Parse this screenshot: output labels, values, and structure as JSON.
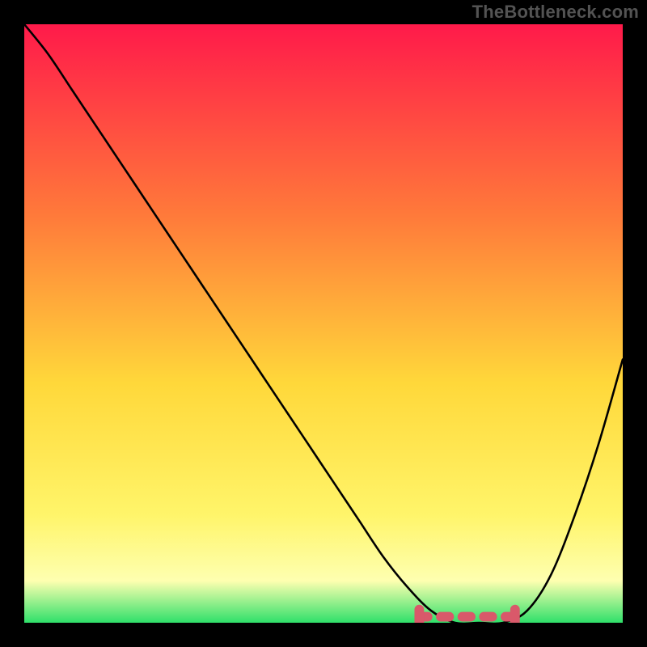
{
  "watermark": "TheBottleneck.com",
  "gradient": {
    "top": "#ff1a4a",
    "q1": "#ff7a3a",
    "mid": "#ffd83a",
    "q3": "#fff56a",
    "band": "#feffb0",
    "bottom": "#2fe06a"
  },
  "chart_data": {
    "type": "line",
    "title": "",
    "xlabel": "",
    "ylabel": "",
    "xlim": [
      0,
      100
    ],
    "ylim": [
      0,
      100
    ],
    "grid": false,
    "legend": false,
    "series": [
      {
        "name": "bottleneck-curve",
        "x": [
          0,
          4,
          8,
          12,
          16,
          20,
          24,
          28,
          32,
          36,
          40,
          44,
          48,
          52,
          56,
          60,
          64,
          68,
          72,
          76,
          80,
          84,
          88,
          92,
          96,
          100
        ],
        "values": [
          100,
          95,
          89,
          83,
          77,
          71,
          65,
          59,
          53,
          47,
          41,
          35,
          29,
          23,
          17,
          11,
          6,
          2,
          0,
          0,
          0,
          2,
          8,
          18,
          30,
          44
        ]
      }
    ],
    "bottom_marker": {
      "name": "optimal-range",
      "color": "#d9596a",
      "x_start": 66,
      "x_end": 82,
      "y": 1.0
    }
  }
}
